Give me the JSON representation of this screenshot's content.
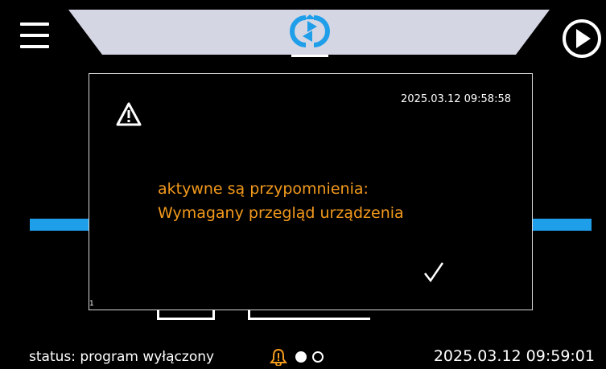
{
  "header": {
    "menu_icon": "hamburger-icon",
    "mode_icon": "cycle-arrows-icon",
    "play_icon": "play-circle-icon",
    "banner_color": "#d5d6e3"
  },
  "dialog": {
    "icon": "warning-triangle-icon",
    "timestamp": "2025.03.12 09:58:58",
    "message_line1": "aktywne są przypomnienia:",
    "message_line2": "Wymagany przegląd urządzenia",
    "confirm_icon": "checkmark-icon",
    "index": "1",
    "message_color": "#f39a1c"
  },
  "status": {
    "text": "status: program wyłączony",
    "alarm_icon": "bell-alert-icon",
    "alarm_color": "#f39a1c",
    "page_dots": [
      "filled",
      "empty"
    ],
    "datetime": "2025.03.12 09:59:01"
  },
  "accent_color": "#1f9ee9"
}
